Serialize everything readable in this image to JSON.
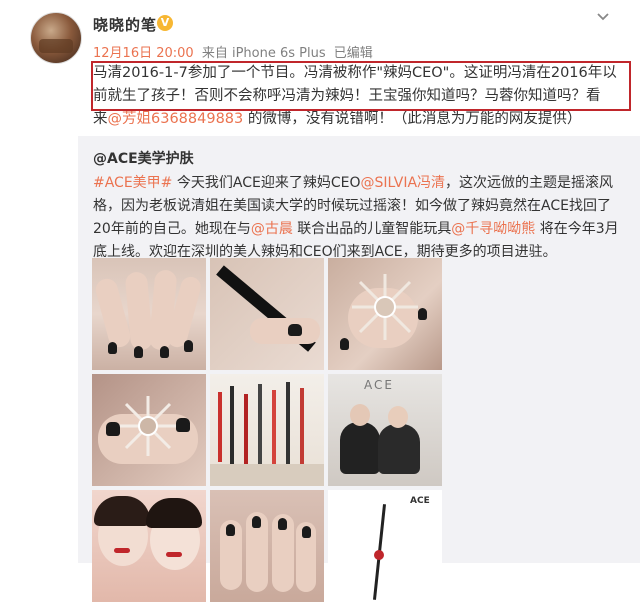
{
  "post": {
    "username": "晓晓的笔",
    "date": "12月16日 20:00",
    "source": "来自 iPhone 6s Plus",
    "edited": "已编辑",
    "text_line1": "马清2016-1-7参加了一个节目。冯清被称作\"辣妈CEO\"。这证明冯清在2016年以",
    "text_line2": "前就生了孩子！否则不会称呼冯清为辣妈！王宝强你知道吗？马蓉你知道吗？看",
    "text_line3_pre": "来",
    "text_line3_link": "@芳姐6368849883",
    "text_line3_post": " 的微博，没有说错啊！（此消息为万能的网友提供）"
  },
  "repost": {
    "author": "@ACE美学护肤",
    "tag": "#ACE美甲#",
    "seg1": " 今天我们ACE迎来了辣妈CEO",
    "mention1": "@SILVIA冯清",
    "seg2": "，这次远倣的主题是摇滚风",
    "line2": "格，因为老板说清姐在美国读大学的时候玩过摇滚！如今做了辣妈竟然在ACE找回了",
    "line3": "20年前的自己。她现在与",
    "mention2": "@古晨",
    "seg3": " 联合出品的儿童智能玩具",
    "mention3": "@千寻呦呦熊",
    "seg4": " 将在今年3月",
    "line5": "底上线。欢迎在深圳的美人辣妈和CEO们来到ACE，期待更多的项目进驻。"
  },
  "photos": {
    "ace_sign": "ACE",
    "book_text": "ACE"
  },
  "colors": {
    "accent": "#eb7350",
    "highlight_border": "#c0262b",
    "repost_bg": "#f2f2f5"
  },
  "icons": {
    "vip_badge": "vip-badge-icon",
    "menu": "chevron-down-icon"
  }
}
